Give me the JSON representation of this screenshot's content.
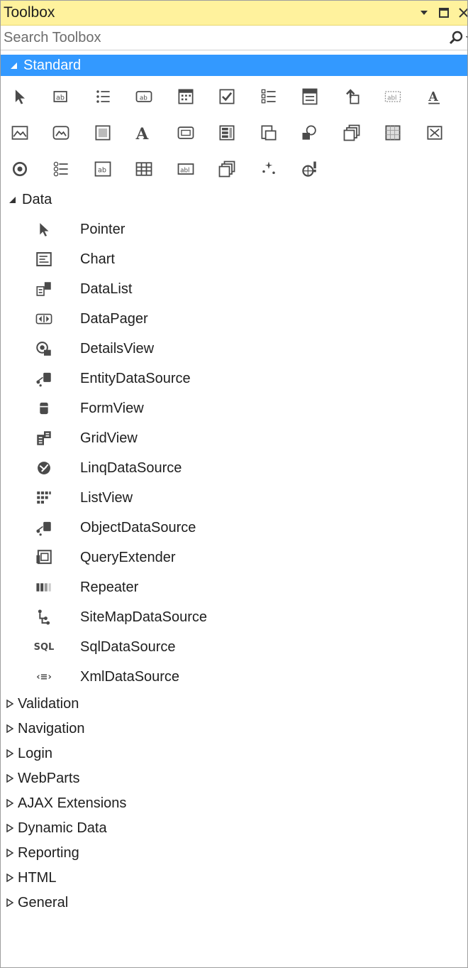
{
  "window": {
    "title": "Toolbox"
  },
  "search": {
    "placeholder": "Search Toolbox"
  },
  "standard": {
    "label": "Standard",
    "icons": [
      "pointer-icon",
      "adrotator-icon",
      "bulletedlist-icon",
      "button-icon",
      "calendar-icon",
      "checkbox-icon",
      "checkboxlist-icon",
      "dropdownlist-icon",
      "fileupload-icon",
      "hiddenfield-icon",
      "hyperlink-icon",
      "image-icon",
      "imagebutton-icon",
      "imagemap-icon",
      "label-icon",
      "linkbutton-icon",
      "listbox-icon",
      "literal-icon",
      "localize-icon",
      "multiview-icon",
      "panel-icon",
      "placeholder-icon",
      "radiobutton-icon",
      "radiobuttonlist-icon",
      "substitution-icon",
      "table-icon",
      "textbox-icon",
      "view-icon",
      "wizard-icon",
      "xml-icon"
    ]
  },
  "data_section": {
    "label": "Data",
    "items": [
      {
        "label": "Pointer",
        "icon": "pointer-icon"
      },
      {
        "label": "Chart",
        "icon": "chart-icon"
      },
      {
        "label": "DataList",
        "icon": "datalist-icon"
      },
      {
        "label": "DataPager",
        "icon": "datapager-icon"
      },
      {
        "label": "DetailsView",
        "icon": "detailsview-icon"
      },
      {
        "label": "EntityDataSource",
        "icon": "entitydatasource-icon"
      },
      {
        "label": "FormView",
        "icon": "formview-icon"
      },
      {
        "label": "GridView",
        "icon": "gridview-icon"
      },
      {
        "label": "LinqDataSource",
        "icon": "linqdatasource-icon"
      },
      {
        "label": "ListView",
        "icon": "listview-icon"
      },
      {
        "label": "ObjectDataSource",
        "icon": "objectdatasource-icon"
      },
      {
        "label": "QueryExtender",
        "icon": "queryextender-icon"
      },
      {
        "label": "Repeater",
        "icon": "repeater-icon"
      },
      {
        "label": "SiteMapDataSource",
        "icon": "sitemapdatasource-icon"
      },
      {
        "label": "SqlDataSource",
        "icon": "sqldatasource-icon",
        "icon_text": "SQL"
      },
      {
        "label": "XmlDataSource",
        "icon": "xmldatasource-icon",
        "icon_text": "‹≡›"
      }
    ]
  },
  "collapsed_sections": [
    {
      "label": "Validation"
    },
    {
      "label": "Navigation"
    },
    {
      "label": "Login"
    },
    {
      "label": "WebParts"
    },
    {
      "label": "AJAX Extensions"
    },
    {
      "label": "Dynamic Data"
    },
    {
      "label": "Reporting"
    },
    {
      "label": "HTML"
    },
    {
      "label": "General"
    }
  ],
  "colors": {
    "title_bar": "#fff29d",
    "selected_header": "#3399ff",
    "icon_gray": "#4a4a4a"
  }
}
